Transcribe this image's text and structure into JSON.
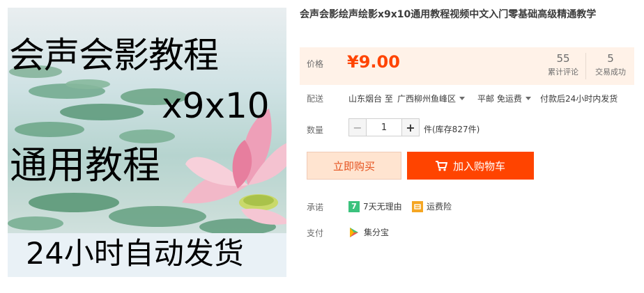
{
  "product_image": {
    "line1": "会声会影教程",
    "line2": "x9x10",
    "line3": "通用教程",
    "caption": "24小时自动发货"
  },
  "title": "会声会影绘声绘影x9x10通用教程视频中文入门零基础高级精通教学",
  "price": {
    "label": "价格",
    "value": "¥9.00",
    "reviews_count": "55",
    "reviews_label": "累计评论",
    "deals_count": "5",
    "deals_label": "交易成功"
  },
  "shipping": {
    "label": "配送",
    "from": "山东烟台 至",
    "to": "广西柳州鱼峰区",
    "method": "平邮 免运费",
    "note": "付款后24小时内发货"
  },
  "quantity": {
    "label": "数量",
    "minus": "−",
    "value": "1",
    "plus": "+",
    "stock": "件(库存827件)"
  },
  "actions": {
    "buy_now": "立即购买",
    "add_to_cart": "加入购物车"
  },
  "promise": {
    "label": "承诺",
    "return_badge": "7",
    "return_text": "7天无理由",
    "insurance_text": "运费险"
  },
  "payment": {
    "label": "支付",
    "method": "集分宝"
  },
  "colors": {
    "accent": "#ff4400",
    "price_bg": "#fff2e8",
    "buy_now_bg": "#ffe4d0",
    "return_badge": "#3bc27d",
    "insurance_badge": "#f5a623"
  },
  "icons": {
    "cart": "cart-icon",
    "return": "seven-day-return-icon",
    "insurance": "shipping-insurance-icon",
    "payment": "jifenbao-icon",
    "caret": "chevron-down-icon"
  }
}
